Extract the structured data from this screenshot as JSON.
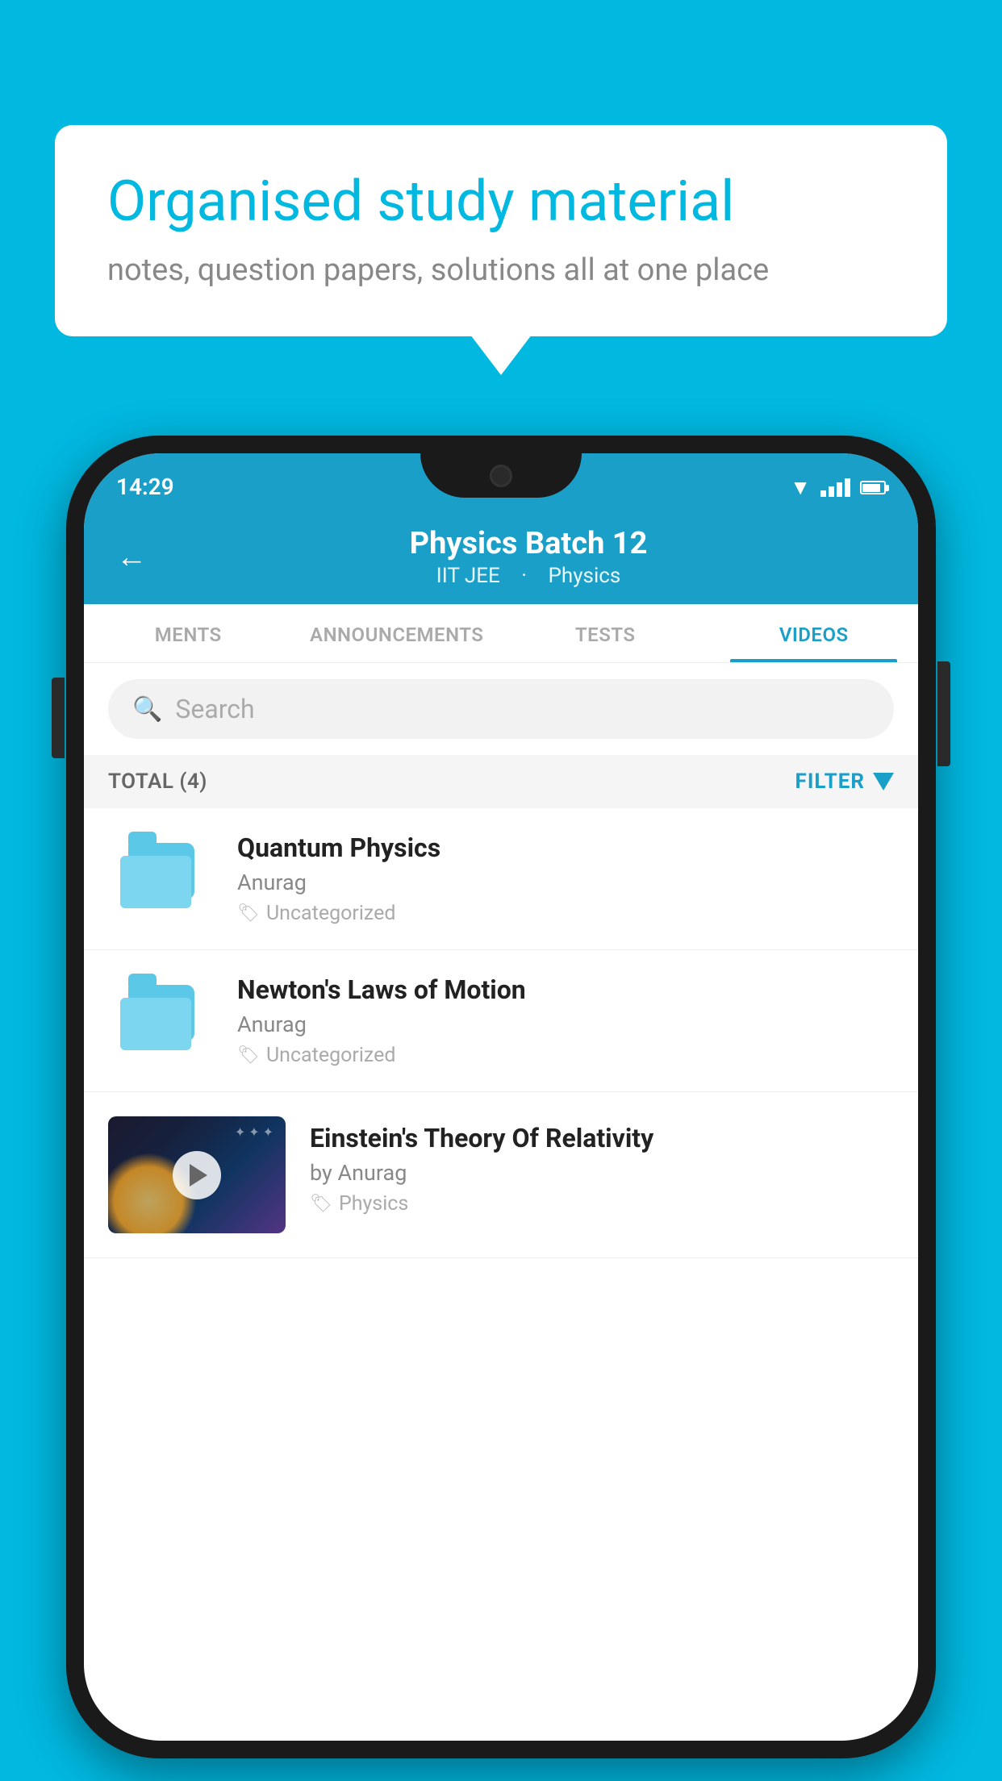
{
  "background_color": "#00b8e0",
  "speech_bubble": {
    "title": "Organised study material",
    "subtitle": "notes, question papers, solutions all at one place"
  },
  "phone": {
    "status_bar": {
      "time": "14:29",
      "wifi": true,
      "signal": true,
      "battery": true
    },
    "header": {
      "back_label": "←",
      "title": "Physics Batch 12",
      "subtitle_part1": "IIT JEE",
      "subtitle_part2": "Physics"
    },
    "tabs": [
      {
        "label": "MENTS",
        "active": false
      },
      {
        "label": "ANNOUNCEMENTS",
        "active": false
      },
      {
        "label": "TESTS",
        "active": false
      },
      {
        "label": "VIDEOS",
        "active": true
      }
    ],
    "search": {
      "placeholder": "Search"
    },
    "filter_bar": {
      "total_label": "TOTAL (4)",
      "filter_label": "FILTER"
    },
    "videos": [
      {
        "title": "Quantum Physics",
        "author": "Anurag",
        "tag": "Uncategorized",
        "type": "folder"
      },
      {
        "title": "Newton's Laws of Motion",
        "author": "Anurag",
        "tag": "Uncategorized",
        "type": "folder"
      },
      {
        "title": "Einstein's Theory Of Relativity",
        "author": "by Anurag",
        "tag": "Physics",
        "type": "video"
      }
    ]
  }
}
